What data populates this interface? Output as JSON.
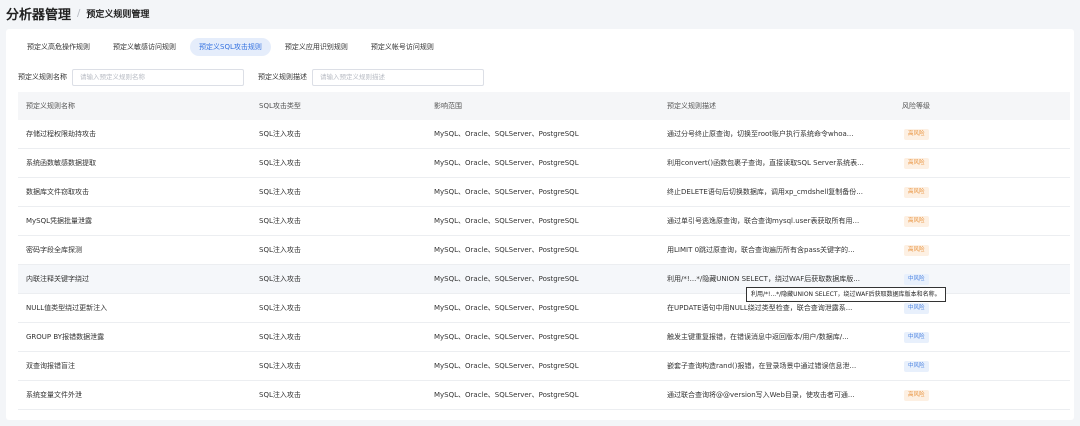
{
  "header": {
    "title": "分析器管理",
    "separator": "/",
    "subtitle": "预定义规则管理"
  },
  "tabs": [
    {
      "label": "预定义高危操作规则",
      "active": false
    },
    {
      "label": "预定义敏感访问规则",
      "active": false
    },
    {
      "label": "预定义SQL攻击规则",
      "active": true
    },
    {
      "label": "预定义应用识别规则",
      "active": false
    },
    {
      "label": "预定义帐号访问规则",
      "active": false
    }
  ],
  "filters": {
    "name_label": "预定义规则名称",
    "name_placeholder": "请输入预定义规则名称",
    "desc_label": "预定义规则描述",
    "desc_placeholder": "请输入预定义规则描述"
  },
  "table": {
    "headers": [
      "预定义规则名称",
      "SQL攻击类型",
      "影响范围",
      "预定义规则描述",
      "风险等级"
    ],
    "rows": [
      {
        "name": "存储过程权限劫持攻击",
        "type": "SQL注入攻击",
        "scope": "MySQL、Oracle、SQLServer、PostgreSQL",
        "desc": "通过分号终止原查询，切换至root账户执行系统命令whoa...",
        "risk": "高风险",
        "level": "high"
      },
      {
        "name": "系统函数敏感数据提取",
        "type": "SQL注入攻击",
        "scope": "MySQL、Oracle、SQLServer、PostgreSQL",
        "desc": "利用convert()函数包裹子查询，直接读取SQL Server系统表...",
        "risk": "高风险",
        "level": "high"
      },
      {
        "name": "数据库文件窃取攻击",
        "type": "SQL注入攻击",
        "scope": "MySQL、Oracle、SQLServer、PostgreSQL",
        "desc": "终止DELETE语句后切换数据库，调用xp_cmdshell复制备份...",
        "risk": "高风险",
        "level": "high"
      },
      {
        "name": "MySQL凭据批量泄露",
        "type": "SQL注入攻击",
        "scope": "MySQL、Oracle、SQLServer、PostgreSQL",
        "desc": "通过单引号逃逸原查询，联合查询mysql.user表获取所有用...",
        "risk": "高风险",
        "level": "high"
      },
      {
        "name": "密码字段全库探测",
        "type": "SQL注入攻击",
        "scope": "MySQL、Oracle、SQLServer、PostgreSQL",
        "desc": "用LIMIT 0跳过原查询，联合查询遍历所有含pass关键字的...",
        "risk": "高风险",
        "level": "high"
      },
      {
        "name": "内联注释关键字绕过",
        "type": "SQL注入攻击",
        "scope": "MySQL、Oracle、SQLServer、PostgreSQL",
        "desc": "利用/*!...*/隐藏UNION SELECT，绕过WAF后获取数据库版...",
        "risk": "中风险",
        "level": "mid"
      },
      {
        "name": "NULL值类型绕过更新注入",
        "type": "SQL注入攻击",
        "scope": "MySQL、Oracle、SQLServer、PostgreSQL",
        "desc": "在UPDATE语句中用NULL绕过类型检查，联合查询泄露系...",
        "risk": "中风险",
        "level": "mid"
      },
      {
        "name": "GROUP BY报错数据泄露",
        "type": "SQL注入攻击",
        "scope": "MySQL、Oracle、SQLServer、PostgreSQL",
        "desc": "触发主键重复报错，在错误消息中返回版本/用户/数据库/...",
        "risk": "中风险",
        "level": "mid"
      },
      {
        "name": "双查询报错盲注",
        "type": "SQL注入攻击",
        "scope": "MySQL、Oracle、SQLServer、PostgreSQL",
        "desc": "嵌套子查询构造rand()报错，在登录场景中通过错误信息泄...",
        "risk": "中风险",
        "level": "mid"
      },
      {
        "name": "系统变量文件外泄",
        "type": "SQL注入攻击",
        "scope": "MySQL、Oracle、SQLServer、PostgreSQL",
        "desc": "通过联合查询将@@version写入Web目录，使攻击者可通...",
        "risk": "高风险",
        "level": "high"
      }
    ]
  },
  "tooltip": {
    "text": "利用/*!...*/隐藏UNION SELECT，绕过WAF后获取数据库版本和名称。"
  }
}
